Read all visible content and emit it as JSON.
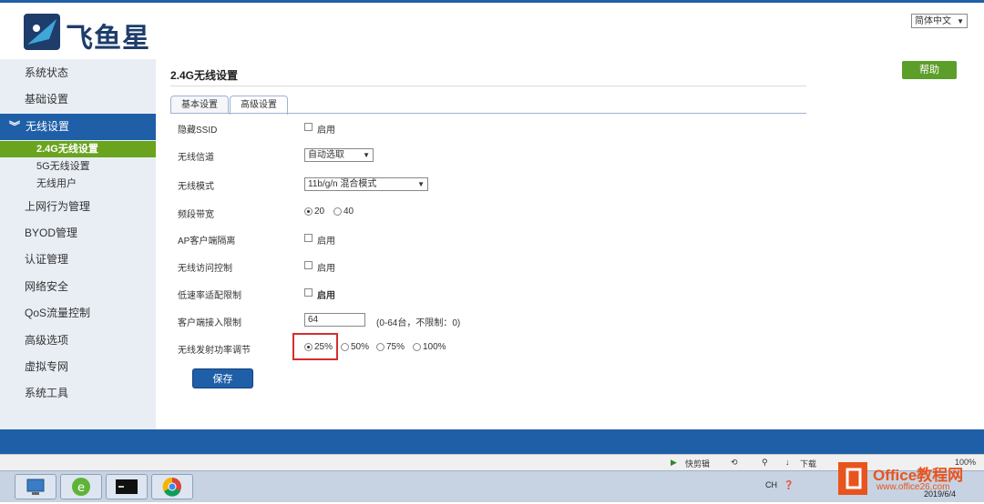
{
  "header": {
    "logo_text": "飞鱼星",
    "language": "简体中文"
  },
  "sidebar": {
    "items": [
      {
        "label": "系统状态"
      },
      {
        "label": "基础设置"
      },
      {
        "label": "无线设置"
      },
      {
        "label": "上网行为管理"
      },
      {
        "label": "BYOD管理"
      },
      {
        "label": "认证管理"
      },
      {
        "label": "网络安全"
      },
      {
        "label": "QoS流量控制"
      },
      {
        "label": "高级选项"
      },
      {
        "label": "虚拟专网"
      },
      {
        "label": "系统工具"
      }
    ],
    "sub_items": [
      {
        "label": "2.4G无线设置"
      },
      {
        "label": "5G无线设置"
      },
      {
        "label": "无线用户"
      }
    ]
  },
  "main": {
    "title": "2.4G无线设置",
    "help": "帮助",
    "tabs": [
      {
        "label": "基本设置"
      },
      {
        "label": "高级设置"
      }
    ],
    "form": {
      "hide_ssid": {
        "label": "隐藏SSID",
        "option": "启用"
      },
      "channel": {
        "label": "无线信道",
        "value": "自动选取"
      },
      "mode": {
        "label": "无线模式",
        "value": "11b/g/n 混合模式"
      },
      "bandwidth": {
        "label": "频段带宽",
        "options": [
          "20",
          "40"
        ],
        "selected": "20"
      },
      "ap_isolation": {
        "label": "AP客户端隔离",
        "option": "启用"
      },
      "access_control": {
        "label": "无线访问控制",
        "option": "启用"
      },
      "low_rate": {
        "label": "低速率适配限制",
        "option": "启用"
      },
      "client_limit": {
        "label": "客户端接入限制",
        "value": "64",
        "hint": "(0-64台，不限制：0)"
      },
      "tx_power": {
        "label": "无线发射功率调节",
        "options": [
          "25%",
          "50%",
          "75%",
          "100%"
        ],
        "selected": "25%"
      }
    },
    "save": "保存"
  },
  "status_bar": {
    "items": [
      "快剪辑",
      "下载",
      "100%"
    ]
  },
  "taskbar": {
    "tray": {
      "lang": "CH",
      "date": "2019/6/4"
    }
  },
  "watermark": {
    "text": "Office教程网",
    "sub": "www.office26.com"
  },
  "colors": {
    "primary": "#1f5fa8",
    "accent": "#6aa41f",
    "help": "#5c9e2a",
    "highlight": "#d32f2f"
  }
}
